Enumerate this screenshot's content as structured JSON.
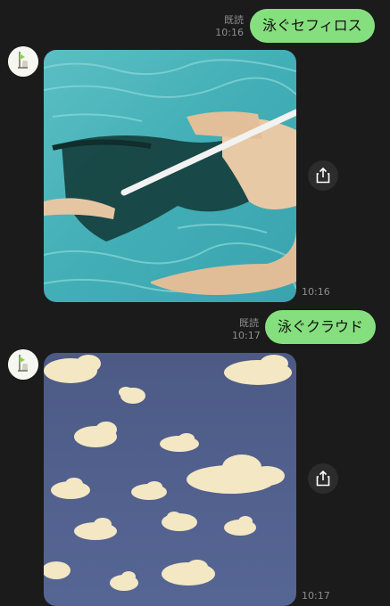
{
  "messages": [
    {
      "type": "sent_text",
      "read_label": "既読",
      "time": "10:16",
      "text": "泳ぐセフィロス"
    },
    {
      "type": "received_image",
      "image_description": "swimmer with long dark hair in turquoise pool",
      "time": "10:16",
      "share_icon": "share-icon"
    },
    {
      "type": "sent_text",
      "read_label": "既読",
      "time": "10:17",
      "text": "泳ぐクラウド"
    },
    {
      "type": "received_image",
      "image_description": "cream clouds on a blue-grey sky",
      "time": "10:17",
      "share_icon": "share-icon"
    }
  ],
  "colors": {
    "background": "#1b1b1b",
    "sent_bubble": "#86df7e",
    "meta_text": "#8e8e8e",
    "share_button": "#2c2c2c"
  }
}
